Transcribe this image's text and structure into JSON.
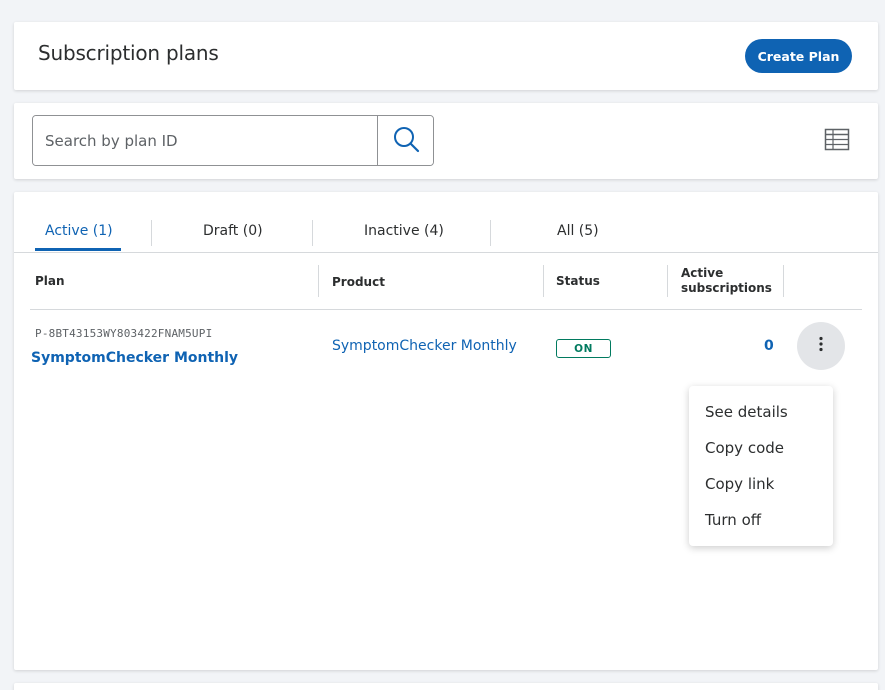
{
  "header": {
    "title": "Subscription plans",
    "create_button": "Create Plan"
  },
  "search": {
    "placeholder": "Search by plan ID",
    "value": "",
    "button_icon": "search-icon",
    "view_toggle_icon": "table-grid-icon"
  },
  "tabs": [
    {
      "label": "Active (1)",
      "active": true
    },
    {
      "label": "Draft (0)",
      "active": false
    },
    {
      "label": "Inactive (4)",
      "active": false
    },
    {
      "label": "All (5)",
      "active": false
    }
  ],
  "table": {
    "headers": {
      "plan": "Plan",
      "product": "Product",
      "status": "Status",
      "active_subs_line1": "Active",
      "active_subs_line2": "subscriptions"
    },
    "rows": [
      {
        "plan_id": "P-8BT43153WY803422FNAM5UPI",
        "plan_name": "SymptomChecker Monthly",
        "product": "SymptomChecker Monthly",
        "status": "ON",
        "active_subscriptions": "0",
        "more_icon": "more-vertical-icon"
      }
    ]
  },
  "row_menu": {
    "items": [
      "See details",
      "Copy code",
      "Copy link",
      "Turn off"
    ]
  },
  "colors": {
    "accent": "#0f63b3",
    "status_on": "#017a5f",
    "background": "#f2f4f7",
    "text": "#2c2e2f"
  }
}
